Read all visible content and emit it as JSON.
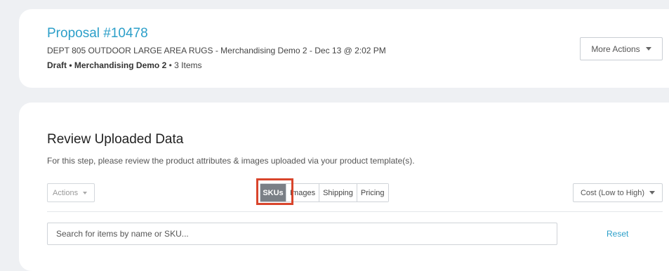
{
  "proposal": {
    "title": "Proposal #10478",
    "subtitle": "DEPT 805 OUTDOOR LARGE AREA RUGS - Merchandising Demo 2 - Dec 13 @ 2:02 PM",
    "status": "Draft",
    "separator1": " • ",
    "company": "Merchandising Demo 2",
    "separator2": " • ",
    "item_count": "3 Items",
    "more_actions_label": "More Actions"
  },
  "review": {
    "title": "Review Uploaded Data",
    "description": "For this step, please review the product attributes & images uploaded via your product template(s).",
    "actions_label": "Actions",
    "tabs": [
      {
        "label": "SKUs",
        "active": true
      },
      {
        "label": "Images",
        "active": false
      },
      {
        "label": "Shipping",
        "active": false
      },
      {
        "label": "Pricing",
        "active": false
      }
    ],
    "sort_label": "Cost (Low to High)",
    "search": {
      "placeholder": "Search for items by name or SKU...",
      "value": ""
    },
    "reset_label": "Reset"
  },
  "colors": {
    "accent": "#2c9fc9",
    "active_tab": "#7a7f86",
    "highlight": "#d9452c"
  }
}
